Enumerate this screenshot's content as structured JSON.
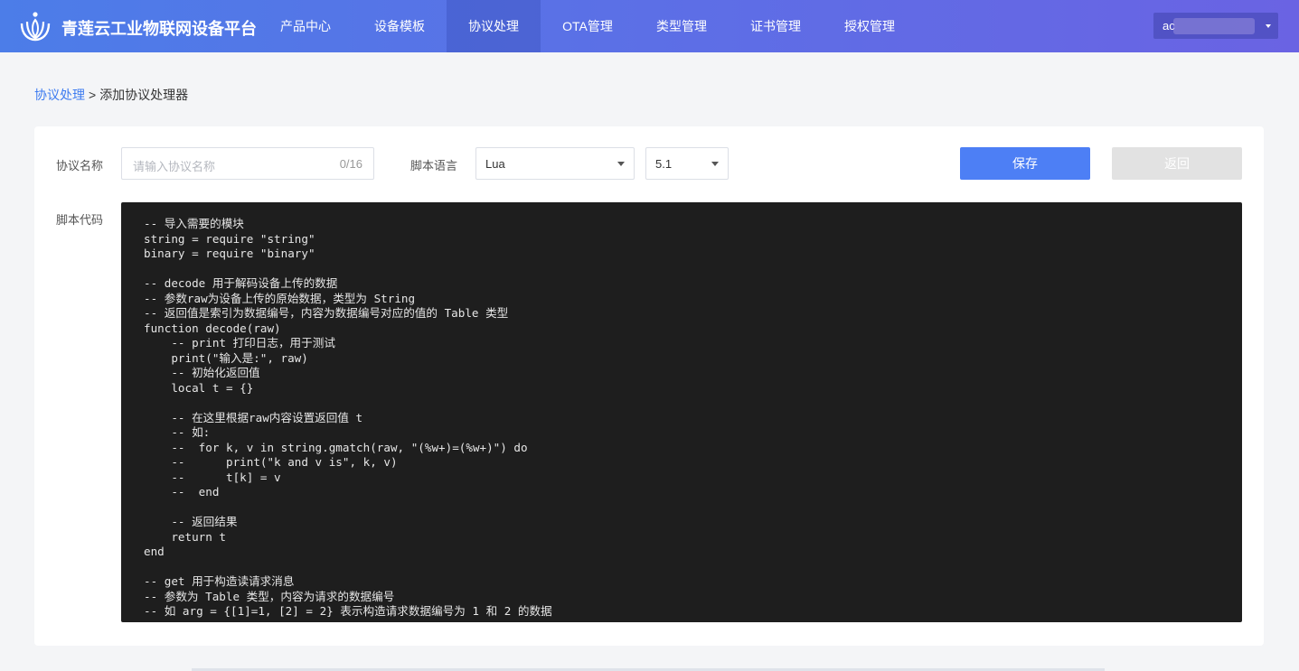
{
  "header": {
    "brand": "青莲云工业物联网设备平台",
    "logo_icon": "lotus-logo-icon",
    "nav": [
      {
        "label": "产品中心",
        "active": false
      },
      {
        "label": "设备模板",
        "active": false
      },
      {
        "label": "协议处理",
        "active": true
      },
      {
        "label": "OTA管理",
        "active": false
      },
      {
        "label": "类型管理",
        "active": false
      },
      {
        "label": "证书管理",
        "active": false
      },
      {
        "label": "授权管理",
        "active": false
      }
    ],
    "user": "ac"
  },
  "breadcrumb": {
    "parent": "协议处理",
    "separator": ">",
    "current": "添加协议处理器"
  },
  "form": {
    "name_label": "协议名称",
    "name_placeholder": "请输入协议名称",
    "name_counter": "0/16",
    "lang_label": "脚本语言",
    "lang_value": "Lua",
    "version_value": "5.1",
    "save_label": "保存",
    "back_label": "返回",
    "code_label": "脚本代码",
    "code": "-- 导入需要的模块\nstring = require \"string\"\nbinary = require \"binary\"\n\n-- decode 用于解码设备上传的数据\n-- 参数raw为设备上传的原始数据，类型为 String\n-- 返回值是索引为数据编号，内容为数据编号对应的值的 Table 类型\nfunction decode(raw)\n    -- print 打印日志，用于测试\n    print(\"输入是:\", raw)\n    -- 初始化返回值\n    local t = {}\n\n    -- 在这里根据raw内容设置返回值 t\n    -- 如:\n    --  for k, v in string.gmatch(raw, \"(%w+)=(%w+)\") do\n    --      print(\"k and v is\", k, v)\n    --      t[k] = v\n    --  end\n\n    -- 返回结果\n    return t\nend\n\n-- get 用于构造读请求消息\n-- 参数为 Table 类型，内容为请求的数据编号\n-- 如 arg = {[1]=1, [2] = 2} 表示构造请求数据编号为 1 和 2 的数据"
  },
  "colors": {
    "primary": "#4d7ff5",
    "header_start": "#4c7de8",
    "header_end": "#6a63e3",
    "code_bg": "#1e1e1e"
  }
}
